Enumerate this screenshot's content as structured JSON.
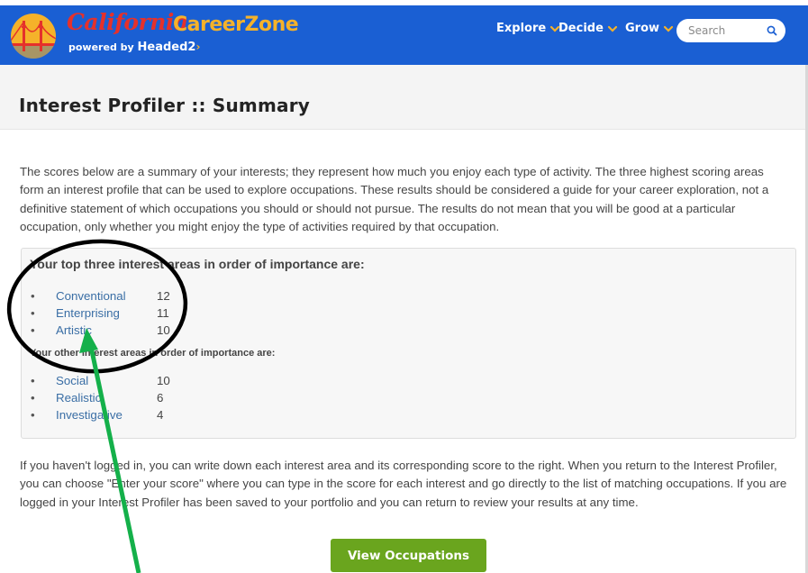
{
  "header": {
    "brand_script": "California",
    "brand_name": "CareerZone",
    "powered_by": "powered by",
    "powered_brand": "Headed2",
    "powered_chevron": "›",
    "nav": [
      {
        "label": "Explore"
      },
      {
        "label": "Decide"
      },
      {
        "label": "Grow"
      }
    ],
    "search_placeholder": "Search"
  },
  "page": {
    "title": "Interest Profiler :: Summary",
    "intro": "The scores below are a summary of your interests; they represent how much you enjoy each type of activity. The three highest scoring areas form an interest profile that can be used to explore occupations. These results should be considered a guide for your career exploration, not a definitive statement of which occupations you should or should not pursue. The results do not mean that you will be good at a particular occupation, only whether you might enjoy the type of activities required by that occupation.",
    "top_heading": "Your top three interest areas in order of importance are:",
    "top_areas": [
      {
        "name": "Conventional",
        "score": "12"
      },
      {
        "name": "Enterprising",
        "score": "11"
      },
      {
        "name": "Artistic",
        "score": "10"
      }
    ],
    "other_heading": "Your other interest areas in order of importance are:",
    "other_areas": [
      {
        "name": "Social",
        "score": "10"
      },
      {
        "name": "Realistic",
        "score": "6"
      },
      {
        "name": "Investigative",
        "score": "4"
      }
    ],
    "outro": "If you haven't logged in, you can write down each interest area and its corresponding score to the right. When you return to the Interest Profiler, you can choose \"Enter your score\" where you can type in the score for each interest and go directly to the list of matching occupations. If you are logged in your Interest Profiler has been saved to your portfolio and you can return to review your results at any time.",
    "button_label": "View Occupations"
  },
  "colors": {
    "header_bg": "#1a5fd3",
    "brand_red": "#e5312b",
    "brand_gold": "#f5b22a",
    "link": "#3a6ea5",
    "button_green": "#6aa51e",
    "annotation_circle": "#000000",
    "annotation_arrow": "#14b04a"
  },
  "icons": {
    "logo": "golden-gate-bridge-icon",
    "nav_chevron": "chevron-down-icon",
    "search": "search-icon"
  }
}
